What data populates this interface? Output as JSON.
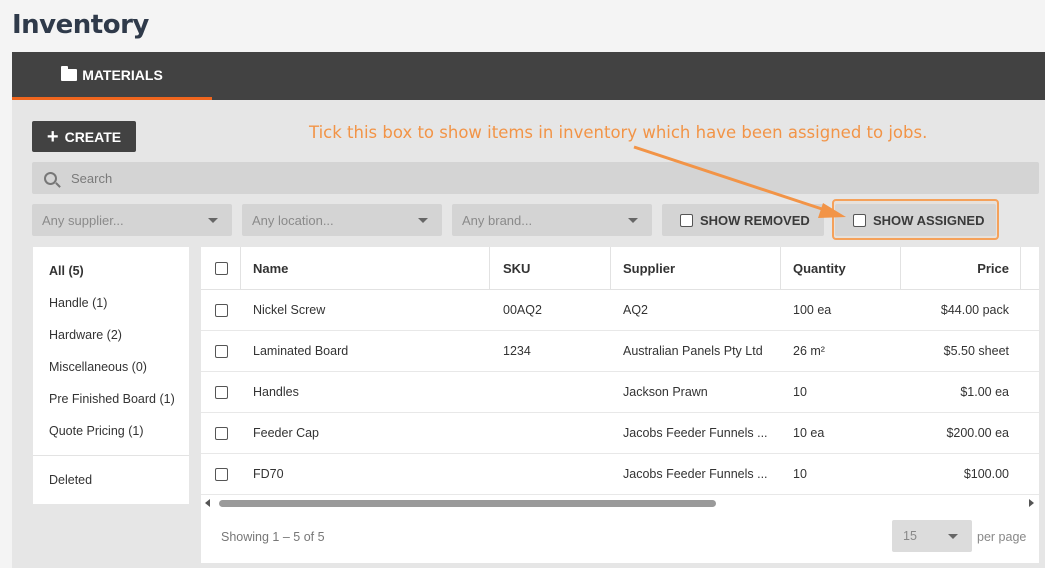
{
  "page": {
    "title": "Inventory"
  },
  "tabs": [
    {
      "label": "MATERIALS",
      "icon": "folder-icon",
      "active": true
    }
  ],
  "accent_color": "#f0661e",
  "annotation": {
    "text": "Tick this box to show items in inventory which have been assigned to jobs.",
    "color": "#f29447"
  },
  "toolbar": {
    "create_label": "CREATE"
  },
  "search": {
    "placeholder": "Search"
  },
  "filters": {
    "supplier": "Any supplier...",
    "location": "Any location...",
    "brand": "Any brand...",
    "show_removed": "SHOW REMOVED",
    "show_assigned": "SHOW ASSIGNED"
  },
  "categories": [
    {
      "label": "All (5)",
      "active": true
    },
    {
      "label": "Handle (1)"
    },
    {
      "label": "Hardware (2)"
    },
    {
      "label": "Miscellaneous (0)"
    },
    {
      "label": "Pre Finished Board (1)"
    },
    {
      "label": "Quote Pricing (1)"
    },
    {
      "label": "Deleted"
    }
  ],
  "table": {
    "columns": [
      "Name",
      "SKU",
      "Supplier",
      "Quantity",
      "Price"
    ],
    "rows": [
      {
        "name": "Nickel Screw",
        "sku": "00AQ2",
        "supplier": "AQ2",
        "quantity": "100 ea",
        "price": "$44.00 pack"
      },
      {
        "name": "Laminated Board",
        "sku": "1234",
        "supplier": "Australian Panels Pty Ltd",
        "quantity": "26 m²",
        "price": "$5.50 sheet"
      },
      {
        "name": "Handles",
        "sku": "",
        "supplier": "Jackson Prawn",
        "quantity": "10",
        "price": "$1.00 ea"
      },
      {
        "name": "Feeder Cap",
        "sku": "",
        "supplier": "Jacobs Feeder Funnels ...",
        "quantity": "10 ea",
        "price": "$200.00 ea"
      },
      {
        "name": "FD70",
        "sku": "",
        "supplier": "Jacobs Feeder Funnels ...",
        "quantity": "10",
        "price": "$100.00"
      }
    ]
  },
  "pagination": {
    "showing": "Showing 1 – 5 of 5",
    "per_page_value": "15",
    "per_page_label": "per page"
  }
}
